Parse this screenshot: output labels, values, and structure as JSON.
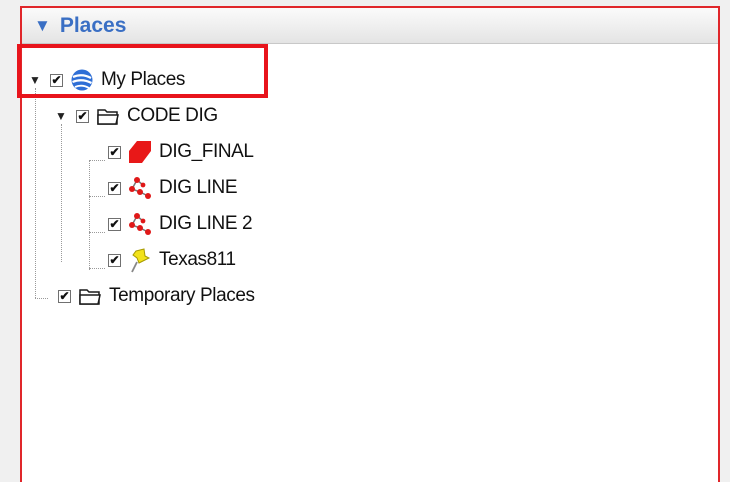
{
  "panel": {
    "title": "Places",
    "collapse_icon": "triangle-down-icon"
  },
  "tree": {
    "my_places": {
      "label": "My Places",
      "icon": "globe-icon",
      "checked": true,
      "expanded": true
    },
    "code_dig": {
      "label": "CODE DIG",
      "icon": "folder-icon",
      "checked": true,
      "expanded": true
    },
    "children": [
      {
        "label": "DIG_FINAL",
        "icon": "polygon-icon",
        "checked": true
      },
      {
        "label": "DIG LINE",
        "icon": "path-icon",
        "checked": true
      },
      {
        "label": "DIG LINE 2",
        "icon": "path-icon",
        "checked": true
      },
      {
        "label": "Texas811",
        "icon": "pushpin-icon",
        "checked": true
      }
    ],
    "temporary": {
      "label": "Temporary Places",
      "icon": "folder-icon",
      "checked": true
    }
  },
  "colors": {
    "accent": "#3a6fc4",
    "highlight": "#e8141c"
  },
  "checkmark": "✔"
}
